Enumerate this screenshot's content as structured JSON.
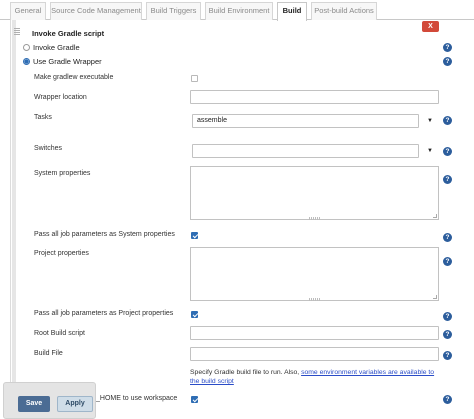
{
  "tabs": [
    {
      "label": "General"
    },
    {
      "label": "Source Code Management"
    },
    {
      "label": "Build Triggers"
    },
    {
      "label": "Build Environment"
    },
    {
      "label": "Build"
    },
    {
      "label": "Post-build Actions"
    }
  ],
  "section": {
    "title": "Invoke Gradle script",
    "close_label": "X"
  },
  "help_icon_glyph": "?",
  "mode": {
    "option_1": "Invoke Gradle",
    "option_2": "Use Gradle Wrapper",
    "selected": "Use Gradle Wrapper"
  },
  "fields": {
    "make_executable": {
      "label": "Make gradlew executable",
      "checked": false
    },
    "wrapper_location": {
      "label": "Wrapper location",
      "value": ""
    },
    "tasks": {
      "label": "Tasks",
      "value": "assemble"
    },
    "switches": {
      "label": "Switches",
      "value": ""
    },
    "system_properties": {
      "label": "System properties",
      "value": ""
    },
    "pass_system": {
      "label": "Pass all job parameters as System properties",
      "checked": true
    },
    "project_properties": {
      "label": "Project properties",
      "value": ""
    },
    "pass_project": {
      "label": "Pass all job parameters as Project properties",
      "checked": true
    },
    "root_build_script": {
      "label": "Root Build script",
      "value": ""
    },
    "build_file": {
      "label": "Build File",
      "value": ""
    },
    "build_file_desc_prefix": "Specify Gradle build file to run. Also,",
    "build_file_desc_link": "some environment variables are available to the build script",
    "workspace": {
      "label_visible_part": "_HOME to use workspace",
      "checked": true
    }
  },
  "footer": {
    "save_label": "Save",
    "apply_label": "Apply"
  },
  "colors": {
    "accent": "#2e6db4",
    "close_red": "#d24939",
    "save_blue": "#4b6c94",
    "link": "#2a4cc7"
  },
  "expand_arrow_glyph": "▼"
}
